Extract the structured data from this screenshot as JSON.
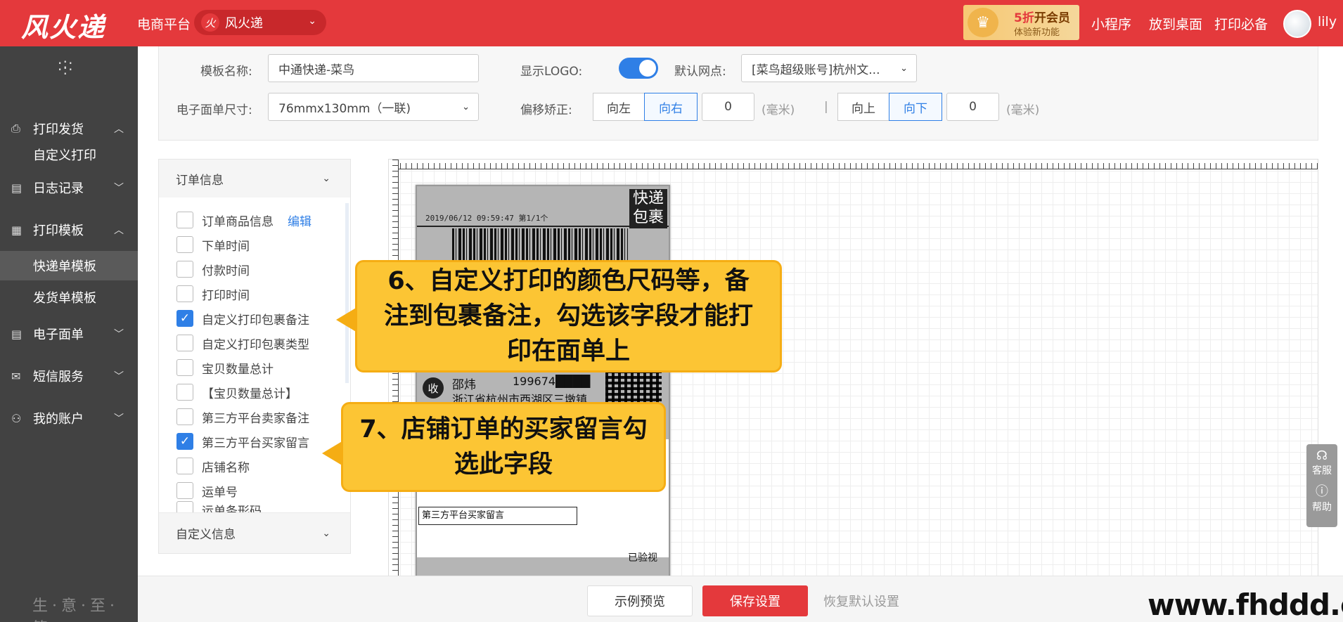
{
  "header": {
    "logo": "风火递",
    "platform_label": "电商平台",
    "platform_icon": "火",
    "platform_value": "风火递",
    "vip_line1_prefix": "5折",
    "vip_line1_suffix": "开会员",
    "vip_line2": "体验新功能",
    "links": [
      "小程序",
      "放到桌面",
      "打印必备"
    ],
    "user": "lily"
  },
  "sidebar": {
    "items": [
      {
        "label": "打印发货",
        "icon": "printer-icon"
      },
      {
        "label": "自定义打印"
      },
      {
        "label": "日志记录",
        "icon": "log-icon"
      },
      {
        "label": "打印模板",
        "icon": "template-icon"
      },
      {
        "label": "快递单模板"
      },
      {
        "label": "发货单模板"
      },
      {
        "label": "电子面单",
        "icon": "waybill-icon"
      },
      {
        "label": "短信服务",
        "icon": "mail-icon"
      },
      {
        "label": "我的账户",
        "icon": "user-icon"
      }
    ],
    "slogan": "生·意·至·简"
  },
  "settings": {
    "template_name_label": "模板名称:",
    "template_name_value": "中通快递-菜鸟",
    "show_logo_label": "显示LOGO:",
    "default_outlet_label": "默认网点:",
    "default_outlet_value": "[菜鸟超级账号]杭州文...",
    "size_label": "电子面单尺寸:",
    "size_value": "76mmx130mm（一联)",
    "offset_label": "偏移矫正:",
    "btn_left": "向左",
    "btn_right": "向右",
    "offset_x": "0",
    "unit_x": "(毫米)",
    "separator": "|",
    "btn_up": "向上",
    "btn_down": "向下",
    "offset_y": "0",
    "unit_y": "(毫米)"
  },
  "fields": {
    "header": "订单信息",
    "edit_label": "编辑",
    "items": [
      {
        "label": "订单商品信息",
        "checked": false
      },
      {
        "label": "下单时间",
        "checked": false
      },
      {
        "label": "付款时间",
        "checked": false
      },
      {
        "label": "打印时间",
        "checked": false
      },
      {
        "label": "自定义打印包裹备注",
        "checked": true
      },
      {
        "label": "自定义打印包裹类型",
        "checked": false
      },
      {
        "label": "宝贝数量总计",
        "checked": false
      },
      {
        "label": "【宝贝数量总计】",
        "checked": false
      },
      {
        "label": "第三方平台卖家备注",
        "checked": false
      },
      {
        "label": "第三方平台买家留言",
        "checked": true
      },
      {
        "label": "店铺名称",
        "checked": false
      },
      {
        "label": "运单号",
        "checked": false
      },
      {
        "label": "运单条形码",
        "checked": false
      }
    ],
    "footer": "自定义信息"
  },
  "label_preview": {
    "date": "2019/06/12   09:59:47   第1/1个",
    "corner": "快递包裹",
    "receiver_badge": "收",
    "receiver_name": "邵炜",
    "receiver_phone": "199674████",
    "receiver_addr": "浙江省杭州市西湖区三墩镇",
    "buyer_msg": "第三方平台买家留言",
    "checked_text": "已验视"
  },
  "callouts": {
    "c6": "6、自定义打印的颜色尺码等，备注到包裹备注，勾选该字段才能打印在面单上",
    "c7": "7、店铺订单的买家留言勾选此字段"
  },
  "float": {
    "service": "客服",
    "help": "帮助"
  },
  "bottom": {
    "preview": "示例预览",
    "save": "保存设置",
    "reset": "恢复默认设置"
  },
  "watermark": "www.fhddd.com"
}
